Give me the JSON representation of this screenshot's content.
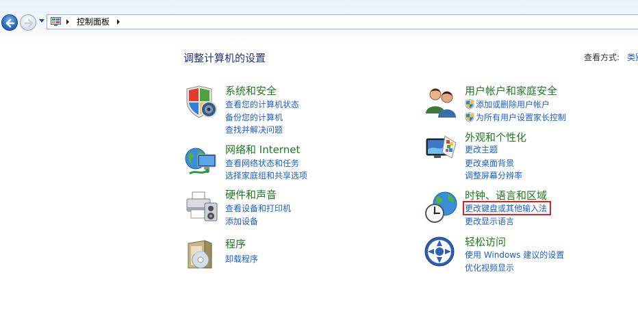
{
  "address_bar": {
    "breadcrumb": "控制面板"
  },
  "header": {
    "title": "调整计算机的设置",
    "view_by_label": "查看方式:",
    "view_by_value": "类别"
  },
  "categories": {
    "system_security": {
      "title": "系统和安全",
      "links": [
        "查看您的计算机状态",
        "备份您的计算机",
        "查找并解决问题"
      ]
    },
    "network": {
      "title": "网络和 Internet",
      "links": [
        "查看网络状态和任务",
        "选择家庭组和共享选项"
      ]
    },
    "hardware": {
      "title": "硬件和声音",
      "links": [
        "查看设备和打印机",
        "添加设备"
      ]
    },
    "programs": {
      "title": "程序",
      "links": [
        "卸载程序"
      ]
    },
    "user_accounts": {
      "title": "用户帐户和家庭安全",
      "links": [
        "添加或删除用户帐户",
        "为所有用户设置家长控制"
      ]
    },
    "appearance": {
      "title": "外观和个性化",
      "links": [
        "更改主题",
        "更改桌面背景",
        "调整屏幕分辨率"
      ]
    },
    "clock_region": {
      "title": "时钟、语言和区域",
      "links": [
        "更改键盘或其他输入法",
        "更改显示语言"
      ]
    },
    "ease_of_access": {
      "title": "轻松访问",
      "links": [
        "使用 Windows 建议的设置",
        "优化视频显示"
      ]
    }
  },
  "colors": {
    "category_title": "#1e7a1e",
    "link": "#1a5fcf",
    "page_title": "#1e3287",
    "highlight_box": "#e02020"
  }
}
